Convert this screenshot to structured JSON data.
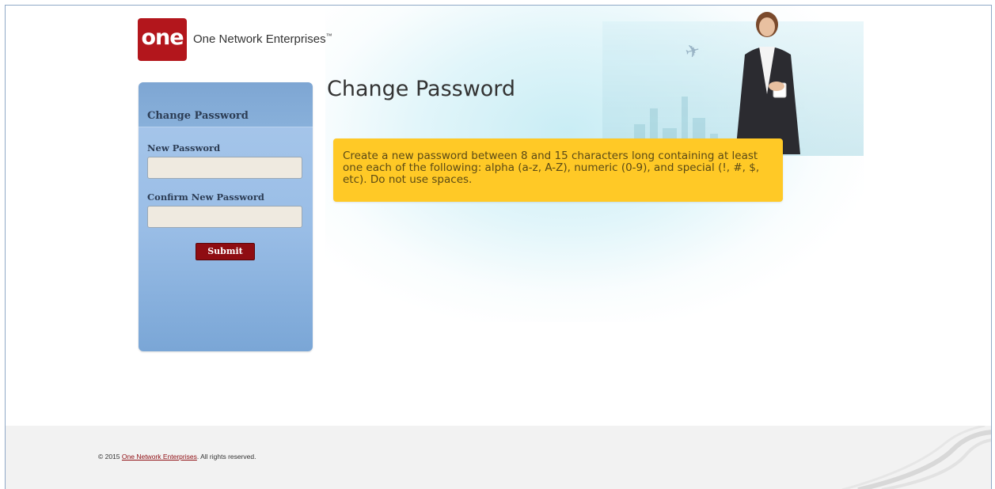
{
  "brand": {
    "logo_text": "one",
    "name": "One Network Enterprises",
    "trademark": "™"
  },
  "panel": {
    "title": "Change Password",
    "new_password_label": "New Password",
    "new_password_value": "",
    "confirm_password_label": "Confirm New Password",
    "confirm_password_value": "",
    "submit_label": "Submit"
  },
  "main": {
    "title": "Change Password",
    "instructions": "Create a new password between 8 and 15 characters long containing at least one each of the following: alpha (a-z, A-Z), numeric (0-9), and special (!, #, $, etc). Do not use spaces."
  },
  "footer": {
    "copyright_prefix": "© 2015 ",
    "company_link": "One Network Enterprises",
    "copyright_suffix": ". All rights reserved."
  },
  "colors": {
    "brand_red": "#b3161c",
    "button_red": "#8f0d12",
    "panel_blue": "#99bde6",
    "notice_yellow": "#ffc926"
  },
  "icons": [
    "one-network-logo",
    "airplane-graphic",
    "businesswoman-photo",
    "swoosh-graphic"
  ]
}
